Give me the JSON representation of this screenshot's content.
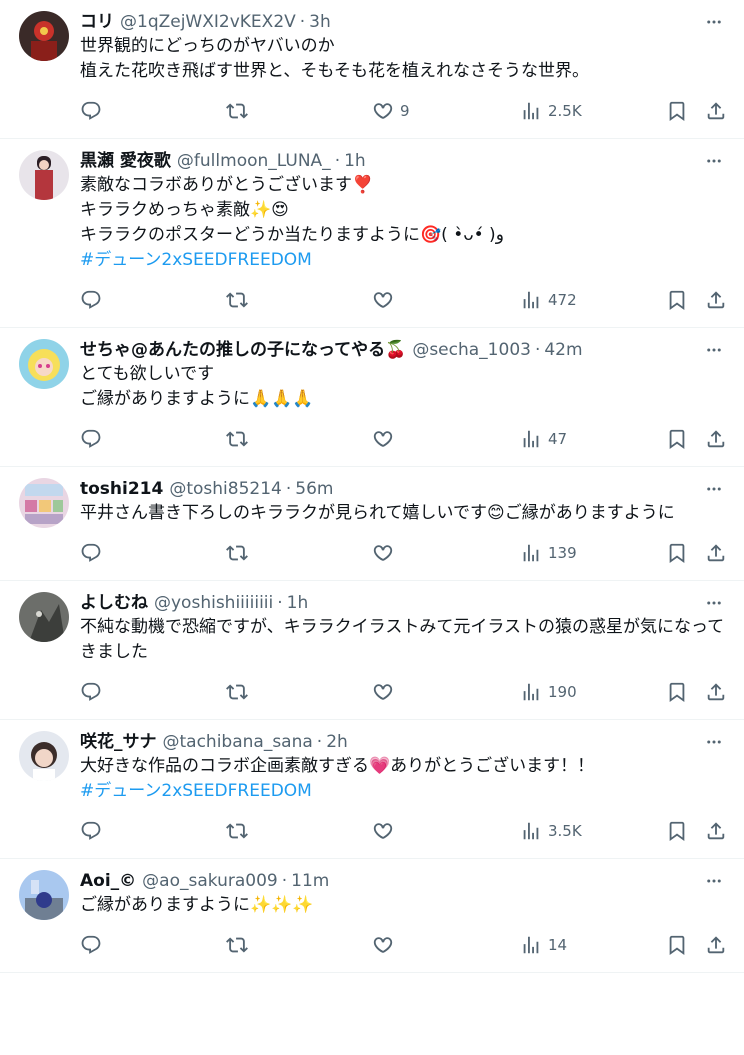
{
  "colors": {
    "text": "#0f1419",
    "secondary": "#536471",
    "link": "#1d9bf0",
    "divider": "#eff3f4"
  },
  "tweets": [
    {
      "name": "コリ",
      "handle": "@1qZejWXI2vKEX2V",
      "time": "3h",
      "lines": [
        "世界観的にどっちのがヤバいのか",
        "植えた花吹き飛ばす世界と、そもそも花を植えれなさそうな世界。"
      ],
      "hashtag": "",
      "likes": "9",
      "views": "2.5K"
    },
    {
      "name": "黒瀬 愛夜歌",
      "handle": "@fullmoon_LUNA_",
      "time": "1h",
      "lines": [
        "素敵なコラボありがとうございます❣️",
        "キララクめっちゃ素敵✨😍",
        "キララクのポスターどうか当たりますように🎯( •̀ᴗ•́ )و"
      ],
      "hashtag": "#デューン2xSEEDFREEDOM",
      "likes": "",
      "views": "472"
    },
    {
      "name": "せちゃ@あんたの推しの子になってやる🍒",
      "handle": "@secha_1003",
      "time": "42m",
      "lines": [
        "とても欲しいです",
        "ご縁がありますように🙏🙏🙏"
      ],
      "hashtag": "",
      "likes": "",
      "views": "47"
    },
    {
      "name": "toshi214",
      "handle": "@toshi85214",
      "time": "56m",
      "lines": [
        "平井さん書き下ろしのキララクが見られて嬉しいです😊ご縁がありますように"
      ],
      "hashtag": "",
      "likes": "",
      "views": "139"
    },
    {
      "name": "よしむね",
      "handle": "@yoshishiiiiiiii",
      "time": "1h",
      "lines": [
        "不純な動機で恐縮ですが、キララクイラストみて元イラストの猿の惑星が気になってきました"
      ],
      "hashtag": "",
      "likes": "",
      "views": "190"
    },
    {
      "name": "咲花_サナ",
      "handle": "@tachibana_sana",
      "time": "2h",
      "lines": [
        "大好きな作品のコラボ企画素敵すぎる💗ありがとうございます！！"
      ],
      "hashtag": "#デューン2xSEEDFREEDOM",
      "likes": "",
      "views": "3.5K"
    },
    {
      "name": "Aoi_©",
      "handle": "@ao_sakura009",
      "time": "11m",
      "lines": [
        "ご縁がありますように✨✨✨"
      ],
      "hashtag": "",
      "likes": "",
      "views": "14"
    }
  ]
}
